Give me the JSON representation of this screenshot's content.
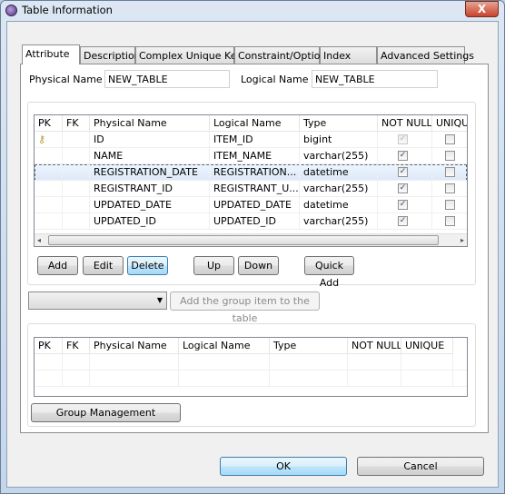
{
  "window": {
    "title": "Table Information",
    "close_label": "X"
  },
  "tabs": [
    "Attribute",
    "Description",
    "Complex Unique Key",
    "Constraint/Option",
    "Index",
    "Advanced Settings"
  ],
  "form": {
    "physical_name_label": "Physical Name",
    "physical_name_value": "NEW_TABLE",
    "logical_name_label": "Logical Name",
    "logical_name_value": "NEW_TABLE"
  },
  "columns_table": {
    "headers": [
      "PK",
      "FK",
      "Physical Name",
      "Logical Name",
      "Type",
      "NOT NULL",
      "UNIQUE"
    ],
    "rows": [
      {
        "pk": true,
        "physical": "ID",
        "logical": "ITEM_ID",
        "type": "bigint",
        "not_null": true,
        "not_null_disabled": true,
        "unique": false
      },
      {
        "pk": false,
        "physical": "NAME",
        "logical": "ITEM_NAME",
        "type": "varchar(255)",
        "not_null": true,
        "unique": false
      },
      {
        "pk": false,
        "physical": "REGISTRATION_DATE",
        "logical": "REGISTRATION...",
        "type": "datetime",
        "not_null": true,
        "unique": false,
        "selected": true
      },
      {
        "pk": false,
        "physical": "REGISTRANT_ID",
        "logical": "REGISTRANT_U...",
        "type": "varchar(255)",
        "not_null": true,
        "unique": false
      },
      {
        "pk": false,
        "physical": "UPDATED_DATE",
        "logical": "UPDATED_DATE",
        "type": "datetime",
        "not_null": true,
        "unique": false
      },
      {
        "pk": false,
        "physical": "UPDATED_ID",
        "logical": "UPDATED_ID",
        "type": "varchar(255)",
        "not_null": true,
        "unique": false
      }
    ]
  },
  "buttons": {
    "add": "Add",
    "edit": "Edit",
    "delete": "Delete",
    "up": "Up",
    "down": "Down",
    "quick_add": "Quick Add",
    "add_group": "Add the group item to the table",
    "group_management": "Group Management",
    "ok": "OK",
    "cancel": "Cancel"
  },
  "group_select": {
    "value": ""
  },
  "group_table": {
    "headers": [
      "PK",
      "FK",
      "Physical Name",
      "Logical Name",
      "Type",
      "NOT NULL",
      "UNIQUE"
    ]
  }
}
